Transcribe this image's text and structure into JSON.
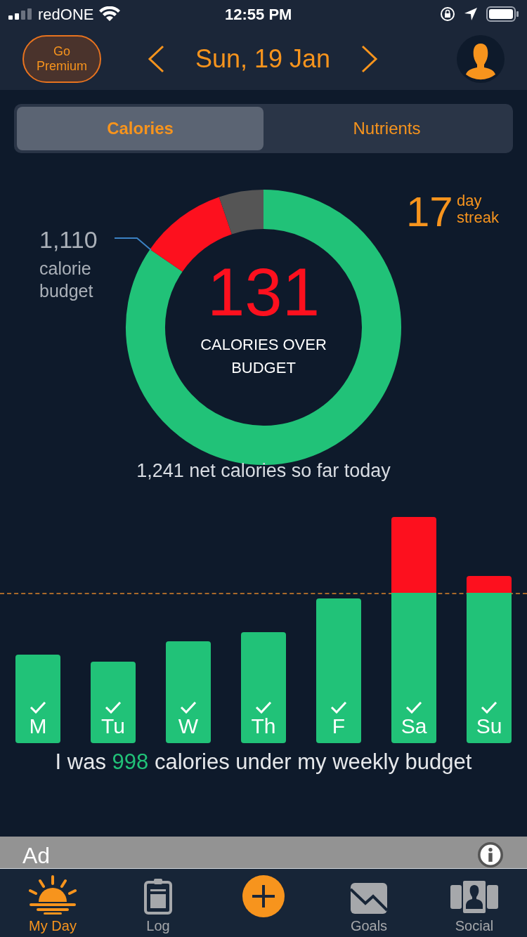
{
  "status_bar": {
    "carrier": "redONE",
    "time": "12:55 PM"
  },
  "header": {
    "premium_button": "Go Premium",
    "date": "Sun, 19 Jan"
  },
  "tabs": [
    {
      "label": "Calories",
      "selected": true
    },
    {
      "label": "Nutrients",
      "selected": false
    }
  ],
  "summary": {
    "budget_value": "1,110",
    "budget_label": "calorie budget",
    "streak_number": "17",
    "streak_label": "day streak",
    "over_value": "131",
    "over_label": "CALORIES OVER BUDGET",
    "net_text": "1,241 net calories so far today"
  },
  "week": {
    "days": [
      {
        "label": "M",
        "checked": true,
        "over": false
      },
      {
        "label": "Tu",
        "checked": true,
        "over": false
      },
      {
        "label": "W",
        "checked": true,
        "over": false
      },
      {
        "label": "Th",
        "checked": true,
        "over": false
      },
      {
        "label": "F",
        "checked": true,
        "over": false
      },
      {
        "label": "Sa",
        "checked": true,
        "over": true
      },
      {
        "label": "Su",
        "checked": true,
        "over": true
      }
    ],
    "sentence": "I was **998** calories under my weekly budget"
  },
  "ad": {
    "label": "Ad"
  },
  "nav": [
    {
      "label": "My Day",
      "kind": "sun",
      "selected": true
    },
    {
      "label": "Log",
      "kind": "clipboard",
      "selected": false
    },
    {
      "kind": "add"
    },
    {
      "label": "Goals",
      "kind": "chart",
      "selected": false
    },
    {
      "label": "Social",
      "kind": "people",
      "selected": false
    }
  ]
}
